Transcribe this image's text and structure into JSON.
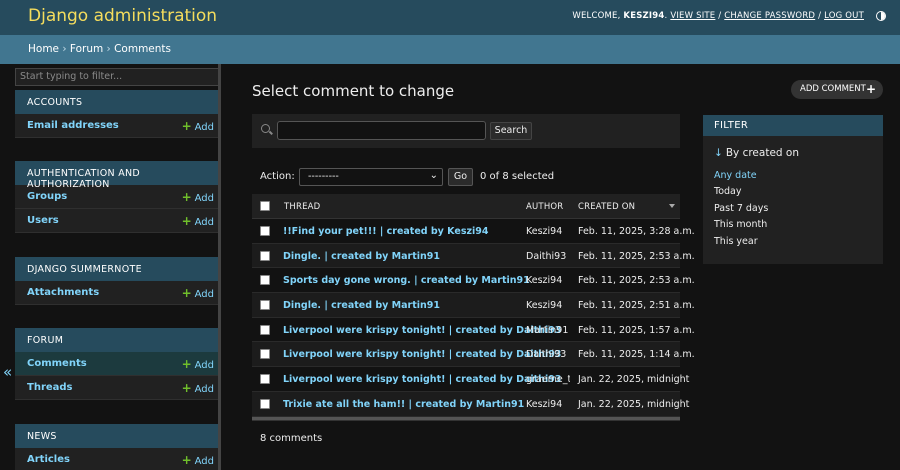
{
  "header": {
    "brand": "Django administration",
    "welcome": "WELCOME,",
    "username": "KESZI94",
    "view_site": "VIEW SITE",
    "change_password": "CHANGE PASSWORD",
    "log_out": "LOG OUT",
    "sep": "/"
  },
  "breadcrumbs": {
    "home": "Home",
    "app": "Forum",
    "current": "Comments",
    "sep": "›"
  },
  "sidebar": {
    "filter_placeholder": "Start typing to filter...",
    "add_label": "Add",
    "collapse_glyph": "«",
    "modules": [
      {
        "caption": "ACCOUNTS",
        "rows": [
          {
            "label": "Email addresses"
          }
        ]
      },
      {
        "caption": "AUTHENTICATION AND AUTHORIZATION",
        "rows": [
          {
            "label": "Groups"
          },
          {
            "label": "Users"
          }
        ]
      },
      {
        "caption": "DJANGO SUMMERNOTE",
        "rows": [
          {
            "label": "Attachments"
          }
        ]
      },
      {
        "caption": "FORUM",
        "rows": [
          {
            "label": "Comments",
            "active": true
          },
          {
            "label": "Threads"
          }
        ]
      },
      {
        "caption": "NEWS",
        "rows": [
          {
            "label": "Articles"
          }
        ]
      }
    ]
  },
  "main": {
    "title": "Select comment to change",
    "add_button": "ADD COMMENT",
    "search_button": "Search",
    "action_label": "Action:",
    "action_value": "---------",
    "go_button": "Go",
    "selected_count": "0 of 8 selected",
    "columns": {
      "thread": "THREAD",
      "author": "AUTHOR",
      "created": "CREATED ON"
    },
    "rows": [
      {
        "thread": "!!Find your pet!!! | created by Keszi94",
        "author": "Keszi94",
        "created": "Feb. 11, 2025, 3:28 a.m."
      },
      {
        "thread": "Dingle. | created by Martin91",
        "author": "Daithi93",
        "created": "Feb. 11, 2025, 2:53 a.m."
      },
      {
        "thread": "Sports day gone wrong. | created by Martin91",
        "author": "Keszi94",
        "created": "Feb. 11, 2025, 2:53 a.m."
      },
      {
        "thread": "Dingle. | created by Martin91",
        "author": "Keszi94",
        "created": "Feb. 11, 2025, 2:51 a.m."
      },
      {
        "thread": "Liverpool were krispy tonight! | created by Daithi93",
        "author": "Martin91",
        "created": "Feb. 11, 2025, 1:57 a.m."
      },
      {
        "thread": "Liverpool were krispy tonight! | created by Daithi93",
        "author": "Daithi93",
        "created": "Feb. 11, 2025, 1:14 a.m."
      },
      {
        "thread": "Liverpool were krispy tonight! | created by Daithi93",
        "author": "graeme_t",
        "created": "Jan. 22, 2025, midnight"
      },
      {
        "thread": "Trixie ate all the ham!! | created by Martin91",
        "author": "Keszi94",
        "created": "Jan. 22, 2025, midnight"
      }
    ],
    "result_count": "8 comments"
  },
  "filter": {
    "title": "FILTER",
    "heading_arrow": "↓",
    "heading": "By created on",
    "options": [
      {
        "label": "Any date",
        "selected": true
      },
      {
        "label": "Today"
      },
      {
        "label": "Past 7 days"
      },
      {
        "label": "This month"
      },
      {
        "label": "This year"
      }
    ]
  },
  "colors": {
    "header_bg": "#264b5d",
    "breadcrumb_bg": "#417690",
    "brand": "#f5dd5d",
    "link": "#81d4fa",
    "add_plus": "#70bf2b",
    "page_bg": "#121212"
  }
}
